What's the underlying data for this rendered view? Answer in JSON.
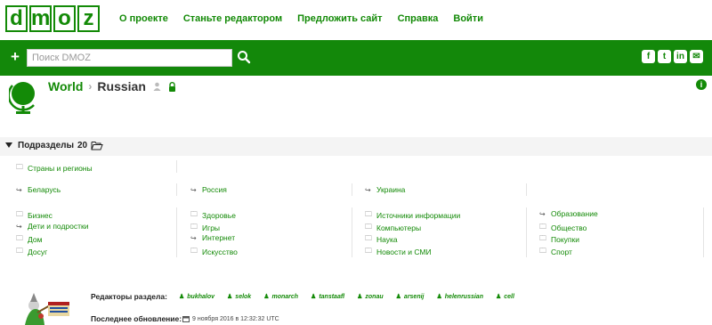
{
  "logo": {
    "letters": [
      "d",
      "m",
      "o",
      "z"
    ]
  },
  "nav": {
    "links": [
      "О проекте",
      "Станьте редактором",
      "Предложить сайт",
      "Справка",
      "Войти"
    ]
  },
  "search": {
    "placeholder": "Поиск DMOZ",
    "value": ""
  },
  "social": [
    "f",
    "t",
    "in",
    "✉"
  ],
  "breadcrumb": {
    "root": "World",
    "current": "Russian"
  },
  "subsections": {
    "title": "Подразделы",
    "count": "20"
  },
  "regions_row": {
    "label": "Страны и регионы"
  },
  "related_row": [
    "Беларусь",
    "Россия",
    "Украина"
  ],
  "categories": {
    "col1": [
      "Бизнес",
      "Дети и подростки",
      "Дом",
      "Досуг"
    ],
    "col2": [
      "Здоровье",
      "Игры",
      "Интернет",
      "Искусство"
    ],
    "col3": [
      "Источники информации",
      "Компьютеры",
      "Наука",
      "Новости и СМИ"
    ],
    "col4": [
      "Образование",
      "Общество",
      "Покупки",
      "Спорт"
    ]
  },
  "editors": {
    "label": "Редакторы раздела:",
    "names": [
      "bukhalov",
      "selok",
      "monarch",
      "tanstaafl",
      "zonau",
      "arsenij",
      "helenrussian",
      "cell"
    ]
  },
  "updated": {
    "label": "Последнее обновление:",
    "value": "9 ноября 2016 в 12:32:32 UTC"
  },
  "colors": {
    "brand_green": "#138a07",
    "bar_green": "#13880a"
  }
}
